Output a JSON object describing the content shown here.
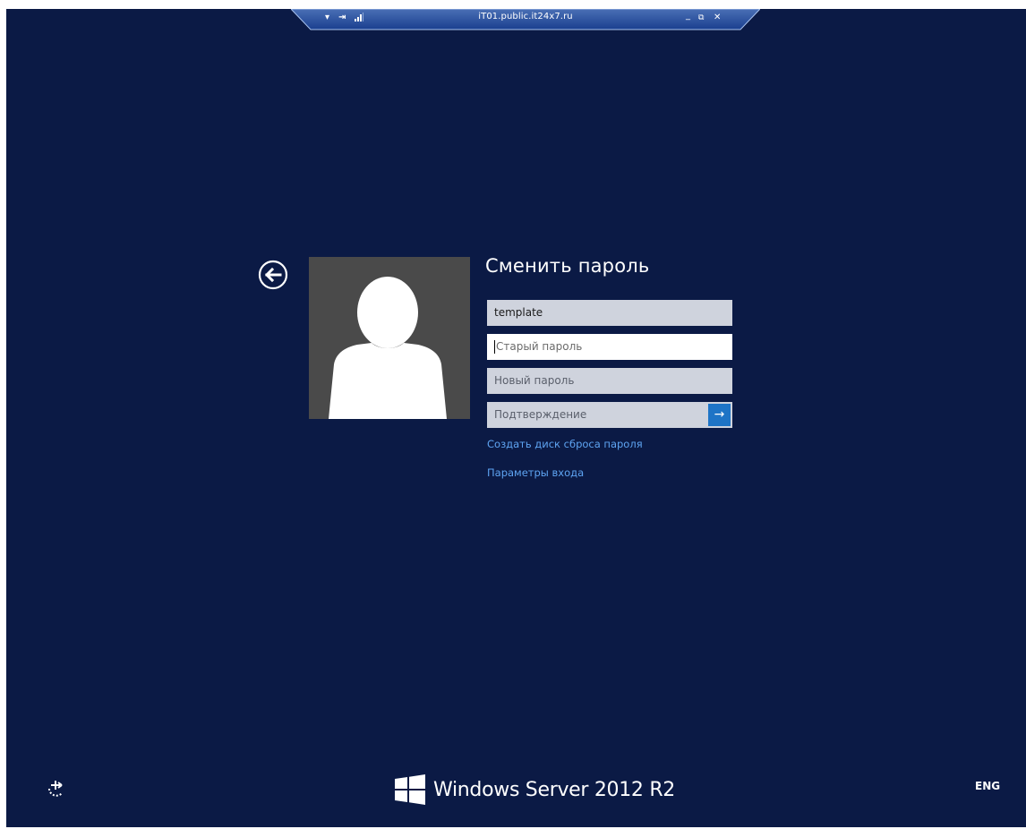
{
  "rdp_bar": {
    "title": "iT01.public.it24x7.ru",
    "icons": [
      "pin-dropdown-icon",
      "pin-icon",
      "signal-icon",
      "minimize-icon",
      "restore-icon",
      "close-icon"
    ],
    "minimize_glyph": "_",
    "restore_glyph": "⧉",
    "close_glyph": "✕",
    "dropdown_glyph": "▾",
    "pin_glyph": "⇥"
  },
  "form": {
    "title": "Сменить пароль",
    "username": "template",
    "old_password_placeholder": "Старый пароль",
    "new_password_placeholder": "Новый пароль",
    "confirm_placeholder": "Подтверждение",
    "submit_glyph": "→",
    "reset_disk_link": "Создать диск сброса пароля",
    "sign_in_options_link": "Параметры входа"
  },
  "footer": {
    "brand": "Windows Server 2012 R2",
    "language": "ENG"
  },
  "colors": {
    "background": "#0b1a45",
    "accent": "#1e74c6",
    "link": "#5ea4f2",
    "field": "#cfd3dd",
    "avatar_bg": "#4a4a4a"
  }
}
